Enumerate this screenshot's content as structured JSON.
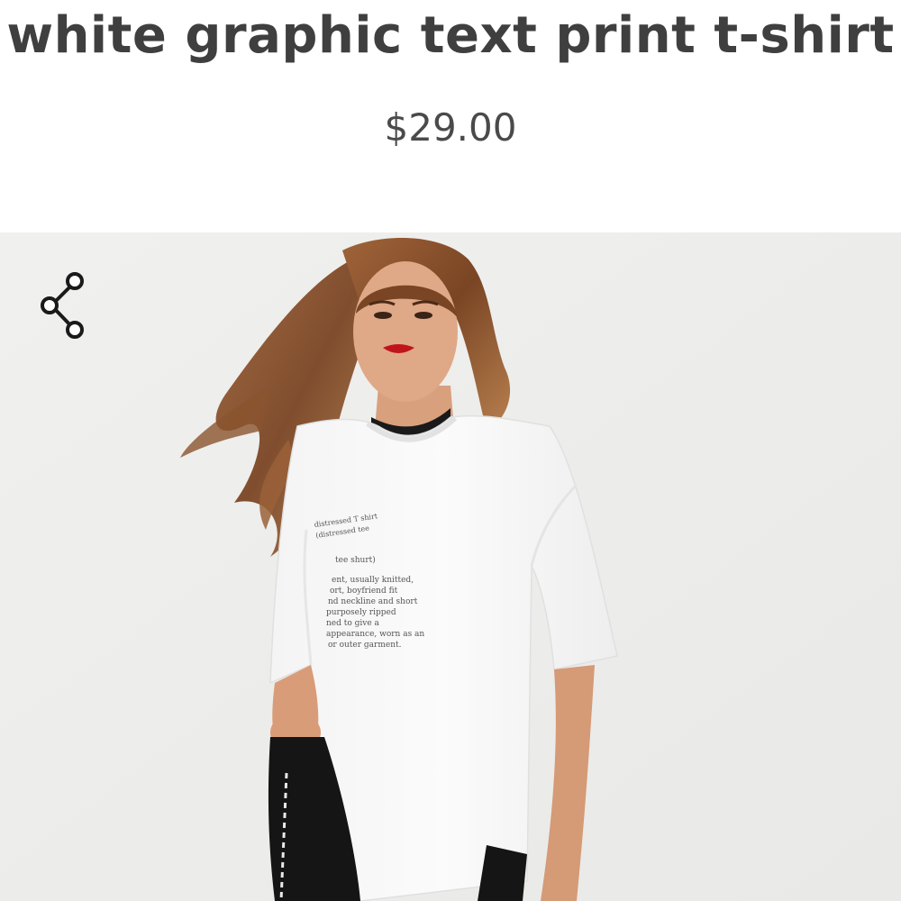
{
  "product": {
    "title": "white graphic text print t-shirt",
    "price": "$29.00"
  },
  "image": {
    "background_color": "#ededeb",
    "shirt_print_lines": [
      "distressed T shirt",
      "(distressed tee",
      "tee shurt)",
      "ent, usually knitted,",
      "ort, boyfriend fit",
      "nd neckline and short",
      "purposely ripped",
      "ned to give a",
      "appearance, worn as an",
      "or outer garment."
    ]
  },
  "share": {
    "icon": "share-icon"
  }
}
